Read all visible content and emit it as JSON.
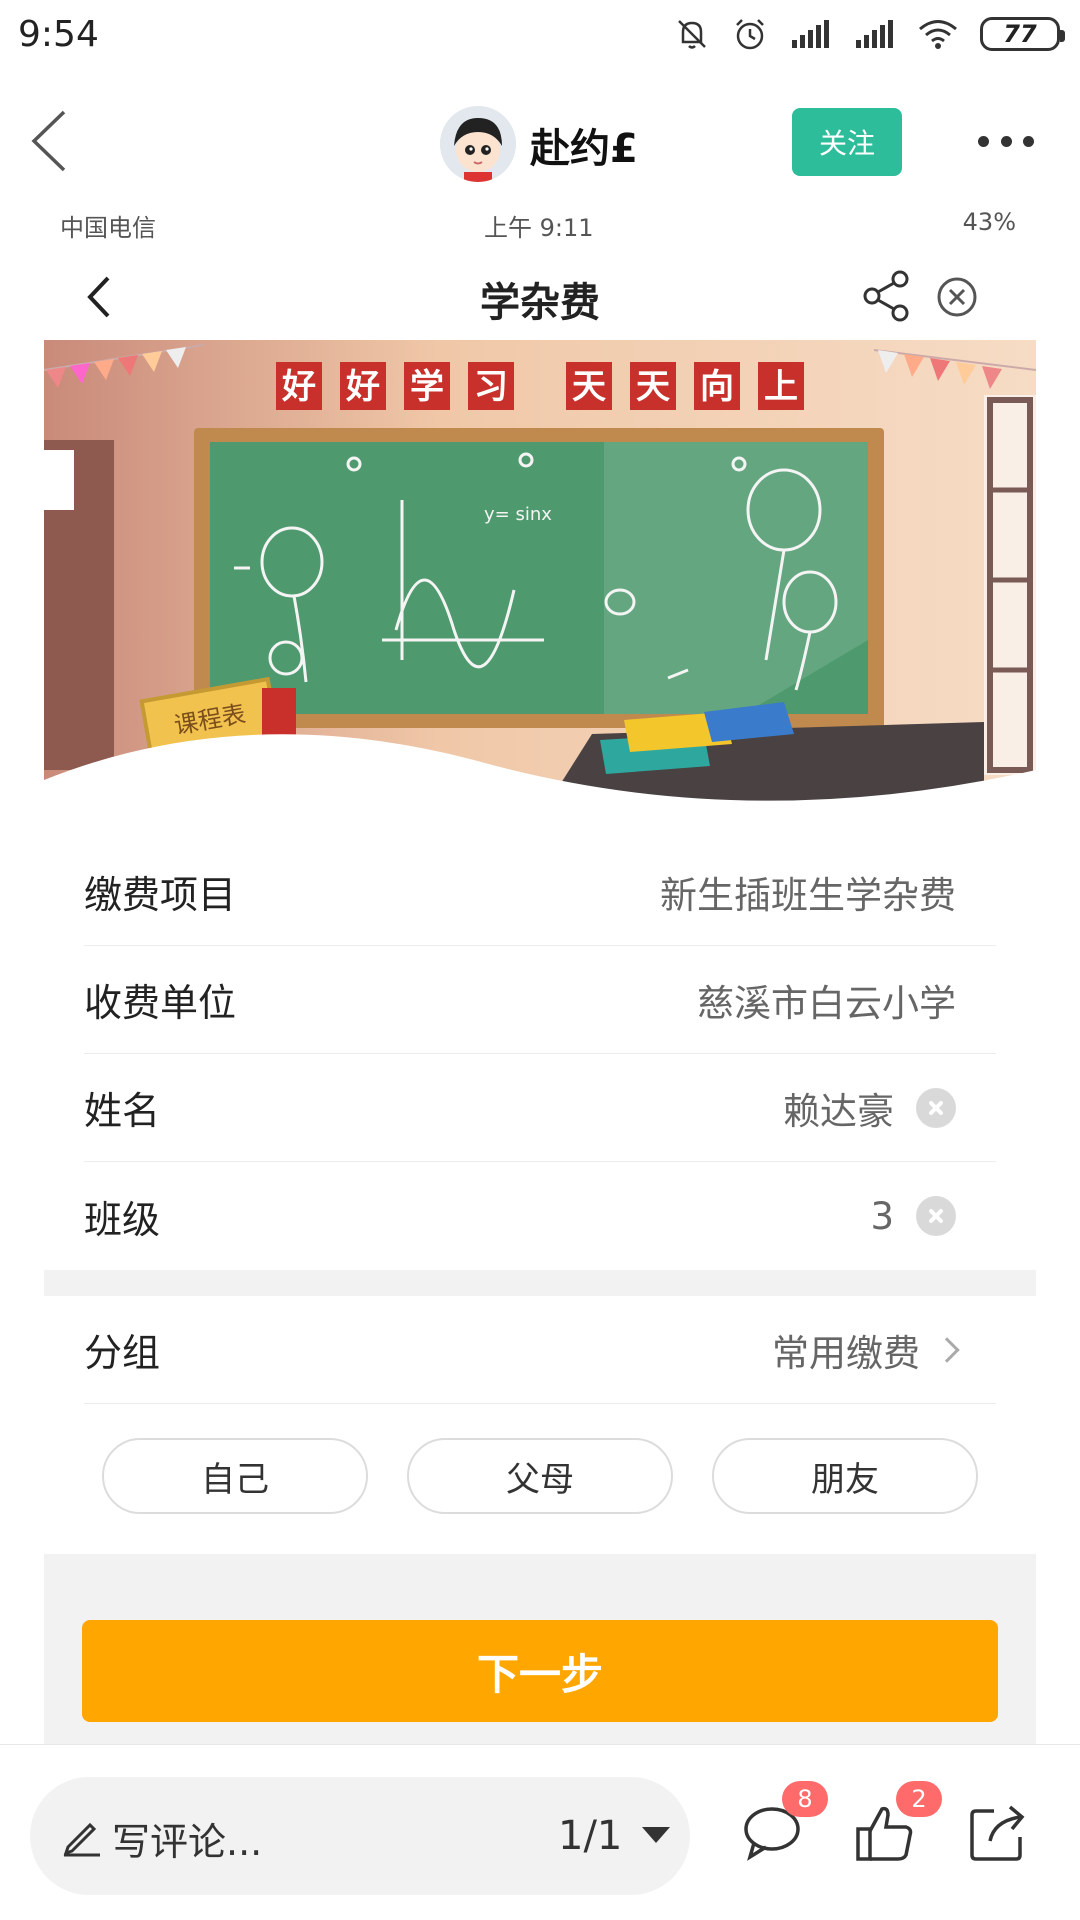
{
  "status_bar": {
    "time": "9:54",
    "battery": "77"
  },
  "header": {
    "author": "赴约£",
    "follow_label": "关注"
  },
  "embedded": {
    "status": {
      "carrier": "中国电信",
      "time": "上午 9:11",
      "battery": "43%"
    },
    "title": "学杂费",
    "banner": {
      "slogan_left": [
        "好",
        "好",
        "学",
        "习"
      ],
      "slogan_right": [
        "天",
        "天",
        "向",
        "上"
      ],
      "board_formula": "y= sinx",
      "schedule_sign": "课程表"
    },
    "fields": [
      {
        "label": "缴费项目",
        "value": "新生插班生学杂费"
      },
      {
        "label": "收费单位",
        "value": "慈溪市白云小学"
      },
      {
        "label": "姓名",
        "value": "赖达豪"
      },
      {
        "label": "班级",
        "value": "3"
      }
    ],
    "group": {
      "label": "分组",
      "value": "常用缴费"
    },
    "chips": [
      "自己",
      "父母",
      "朋友"
    ],
    "next_label": "下一步"
  },
  "bottom_bar": {
    "comment_placeholder": "写评论...",
    "page_counter": "1/1",
    "comment_badge": "8",
    "like_badge": "2"
  },
  "colors": {
    "follow": "#2ebd9b",
    "next_button": "#ffa600",
    "badge": "#ff6b6b",
    "chalkboard": "#4e9a6e"
  }
}
